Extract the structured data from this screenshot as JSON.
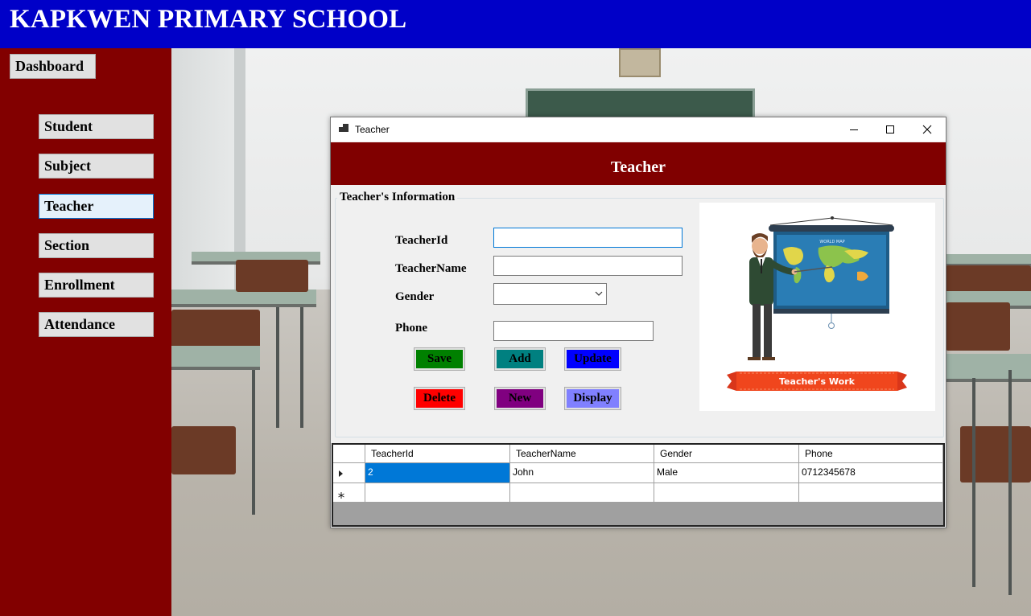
{
  "app": {
    "title": "KAPKWEN PRIMARY SCHOOL"
  },
  "sidebar": {
    "dashboard": "Dashboard",
    "items": [
      {
        "label": "Student"
      },
      {
        "label": "Subject"
      },
      {
        "label": "Teacher",
        "active": true
      },
      {
        "label": "Section"
      },
      {
        "label": "Enrollment"
      },
      {
        "label": "Attendance"
      }
    ]
  },
  "window": {
    "title": "Teacher",
    "heading": "Teacher",
    "group_title": "Teacher's Information",
    "fields": {
      "teacher_id": {
        "label": "TeacherId",
        "value": ""
      },
      "teacher_name": {
        "label": "TeacherName",
        "value": ""
      },
      "gender": {
        "label": "Gender",
        "value": ""
      },
      "phone": {
        "label": "Phone",
        "value": ""
      }
    },
    "buttons": {
      "save": "Save",
      "add": "Add",
      "update": "Update",
      "delete": "Delete",
      "new": "New",
      "display": "Display"
    },
    "button_colors": {
      "save": "#008000",
      "add": "#008080",
      "update": "#0000ff",
      "delete": "#ff0000",
      "new": "#800080",
      "display": "#8080ff"
    },
    "illustration": {
      "ribbon_text": "Teacher's Work",
      "map_title": "WORLD MAP"
    }
  },
  "grid": {
    "columns": [
      "TeacherId",
      "TeacherName",
      "Gender",
      "Phone"
    ],
    "rows": [
      {
        "teacher_id": "2",
        "teacher_name": "John",
        "gender": "Male",
        "phone": "0712345678"
      }
    ]
  },
  "colors": {
    "header_blue": "#0000c8",
    "sidebar_red": "#820000",
    "banner_maroon": "#800000",
    "selection_blue": "#0078d7"
  }
}
